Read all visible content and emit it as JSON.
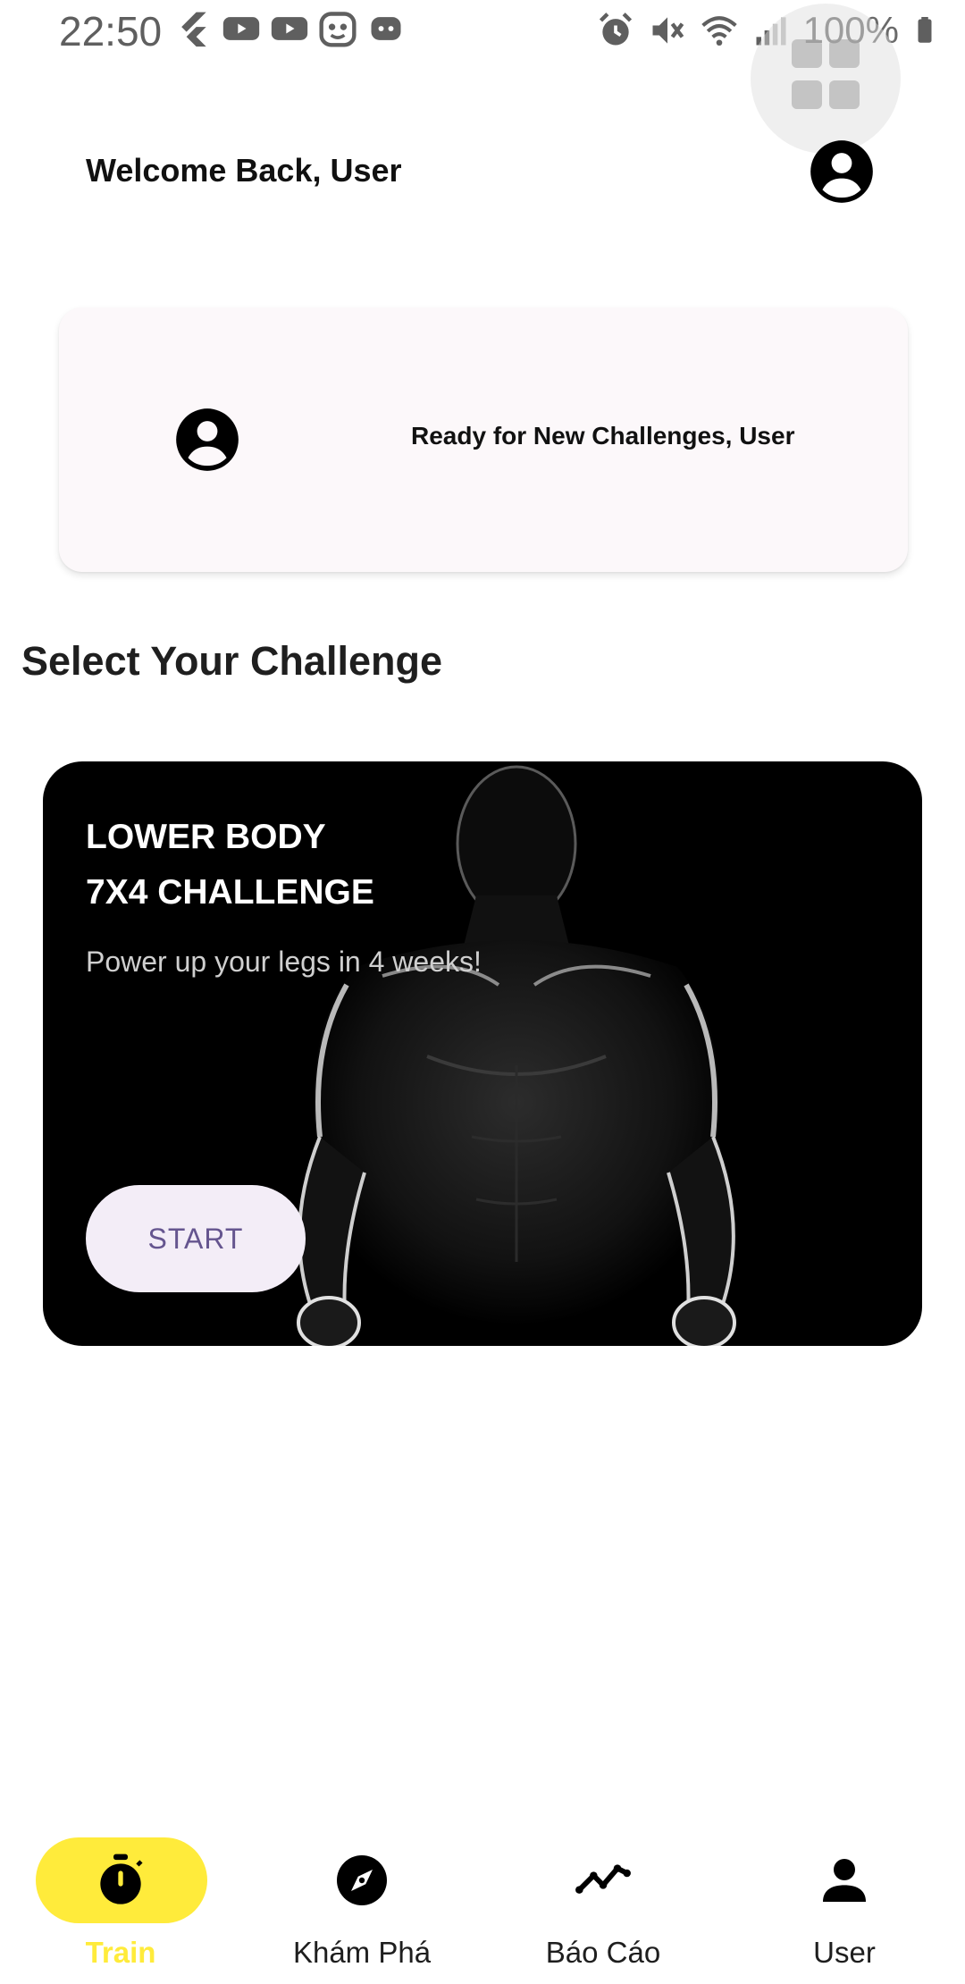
{
  "status_bar": {
    "time": "22:50",
    "battery": "100%",
    "left_icons": [
      "flutter-icon",
      "youtube-icon",
      "youtube-icon",
      "app-icon",
      "game-icon"
    ],
    "right_icons": [
      "alarm-icon",
      "mute-icon",
      "wifi-icon",
      "signal-icon",
      "battery-icon"
    ]
  },
  "header": {
    "title": "Welcome Back, User"
  },
  "greeting_card": {
    "text": "Ready for New Challenges, User"
  },
  "section": {
    "title": "Select Your Challenge"
  },
  "challenge": {
    "title": "LOWER BODY\n7X4 CHALLENGE",
    "subtitle": "Power up your legs in 4 weeks!",
    "button_label": "START"
  },
  "bottom_nav": {
    "items": [
      {
        "label": "Train",
        "icon": "timer-icon",
        "active": true
      },
      {
        "label": "Khám Phá",
        "icon": "compass-icon",
        "active": false
      },
      {
        "label": "Báo Cáo",
        "icon": "trend-icon",
        "active": false
      },
      {
        "label": "User",
        "icon": "person-icon",
        "active": false
      }
    ]
  },
  "colors": {
    "accent": "#ffeb3b",
    "button_text": "#65558f",
    "button_bg": "#f3edf7",
    "card_bg": "#fcf8fa"
  }
}
